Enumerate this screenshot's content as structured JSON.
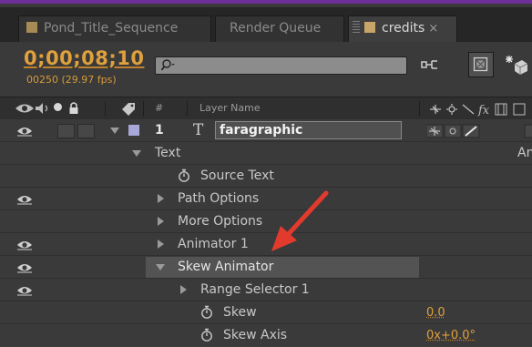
{
  "tabs": [
    {
      "label": "Pond_Title_Sequence",
      "chip_color": "#a88a55"
    },
    {
      "label": "Render Queue"
    },
    {
      "label": "credits",
      "chip_color": "#c8a468",
      "close_glyph": "×"
    }
  ],
  "composition": {
    "timecode": "0;00;08;10",
    "frames": "00250 (29.97 fps)",
    "search_placeholder": ""
  },
  "header": {
    "number_label": "#",
    "layer_name_label": "Layer Name"
  },
  "layer": {
    "number": "1",
    "type_glyph": "T",
    "name": "faragraphic",
    "label_color": "#a7a7d9"
  },
  "properties": {
    "text": "Text",
    "source_text": "Source Text",
    "path_options": "Path Options",
    "more_options": "More Options",
    "animator1": "Animator 1",
    "skew_animator": "Skew Animator",
    "range_selector": "Range Selector 1",
    "skew": "Skew",
    "skew_value": "0.0",
    "skew_axis": "Skew Axis",
    "skew_axis_value": "0x+0.0°",
    "right_cut_text": "An"
  },
  "annotation": {
    "arrow_color": "#e23b2e"
  },
  "colors": {
    "accent": "#e0a03c",
    "selected_row": "#535353",
    "frame": "#6d2f9a"
  }
}
